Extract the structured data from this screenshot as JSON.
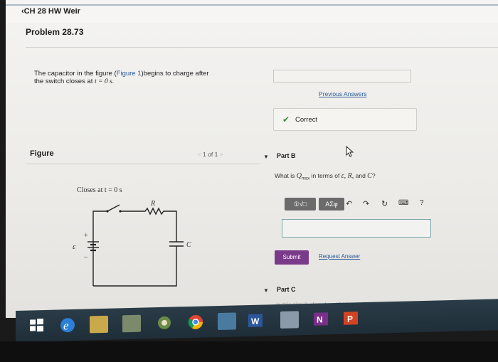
{
  "header": {
    "back_label": "‹CH 28 HW Weir"
  },
  "problem": {
    "title": "Problem 28.73",
    "text_before_link": "The capacitor in the figure (",
    "figure_link": "Figure 1",
    "text_after_link": ")begins to charge after",
    "line2": "the switch closes at ",
    "line2_math": "t = 0 s",
    "line2_end": "."
  },
  "part_a": {
    "previous_answers": "Previous Answers",
    "status": "Correct"
  },
  "figure": {
    "label": "Figure",
    "pager": "1 of 1",
    "caption": "Closes at t = 0 s",
    "labels": {
      "resistor": "R",
      "capacitor": "C",
      "emf": "ɛ",
      "plus": "+",
      "minus": "–"
    }
  },
  "part_b": {
    "label": "Part B",
    "question_prefix": "What is ",
    "question_var": "Q",
    "question_sub": "max",
    "question_mid": " in terms of ",
    "question_vars": "ɛ, R,",
    "question_and": " and ",
    "question_c": "C",
    "question_end": "?",
    "toolbar": {
      "templates": "①√□",
      "symbols": "AΣφ",
      "help": "?"
    },
    "submit": "Submit",
    "request_answer": "Request Answer"
  },
  "part_c": {
    "label": "Part C",
    "text": "In this circuit, does I ... dQ/dt or ... dQ/dt"
  },
  "colors": {
    "accent_link": "#2a5a9a",
    "submit_bg": "#7a3a8a",
    "correct_check": "#3a8a3a",
    "taskbar": "#223440"
  },
  "taskbar_icons": [
    "windows-start-icon",
    "edge-icon",
    "file-explorer-icon",
    "store-icon",
    "photos-icon",
    "chrome-icon",
    "media-icon",
    "word-icon",
    "app-icon",
    "onenote-icon",
    "powerpoint-icon"
  ]
}
